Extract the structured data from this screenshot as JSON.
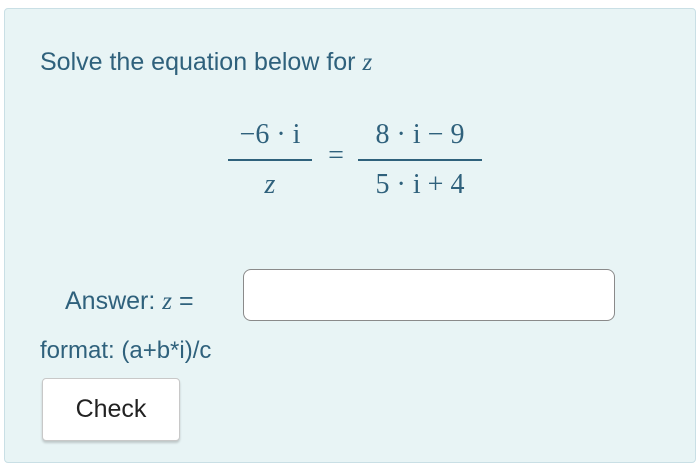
{
  "prompt": {
    "text": "Solve the equation below for ",
    "variable": "z"
  },
  "equation": {
    "left_numerator": "−6 · i",
    "left_denominator": "z",
    "equals": "=",
    "right_numerator": "8 · i − 9",
    "right_denominator": "5 · i + 4"
  },
  "answer": {
    "label": "Answer: ",
    "variable": "z",
    "equals": " =",
    "value": "",
    "placeholder": ""
  },
  "format_hint": "format: (a+b*i)/c",
  "check_button": {
    "label": "Check"
  },
  "colors": {
    "panel_background": "#e8f4f5",
    "text": "#2f617c"
  }
}
